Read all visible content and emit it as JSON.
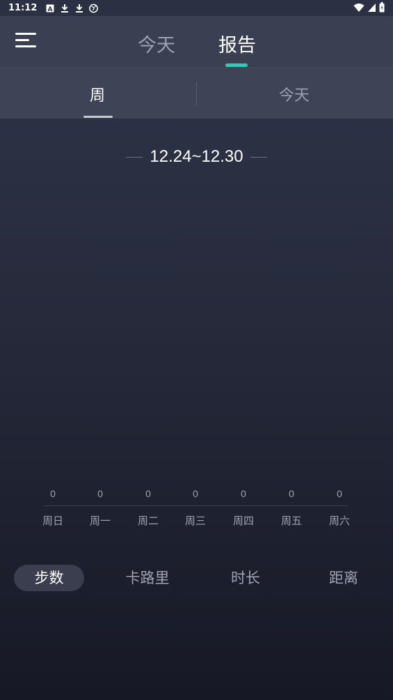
{
  "status_bar": {
    "time": "11:12",
    "left_icons": [
      "font-icon",
      "download-icon",
      "download-icon",
      "globe-icon"
    ],
    "right_icons": [
      "wifi-icon",
      "signal-icon",
      "battery-icon"
    ]
  },
  "header": {
    "tabs": [
      {
        "label": "今天",
        "active": false
      },
      {
        "label": "报告",
        "active": true
      }
    ],
    "accent_color": "#1ed4b8"
  },
  "subtabs": [
    {
      "label": "周",
      "active": true
    },
    {
      "label": "今天",
      "active": false
    }
  ],
  "date_range": "12.24~12.30",
  "chart_data": {
    "type": "bar",
    "categories": [
      "周日",
      "周一",
      "周二",
      "周三",
      "周四",
      "周五",
      "周六"
    ],
    "values": [
      0,
      0,
      0,
      0,
      0,
      0,
      0
    ],
    "value_labels": [
      "0",
      "0",
      "0",
      "0",
      "0",
      "0",
      "0"
    ],
    "title": "",
    "xlabel": "",
    "ylabel": ""
  },
  "metrics": [
    {
      "label": "步数",
      "active": true
    },
    {
      "label": "卡路里",
      "active": false
    },
    {
      "label": "时长",
      "active": false
    },
    {
      "label": "距离",
      "active": false
    }
  ]
}
